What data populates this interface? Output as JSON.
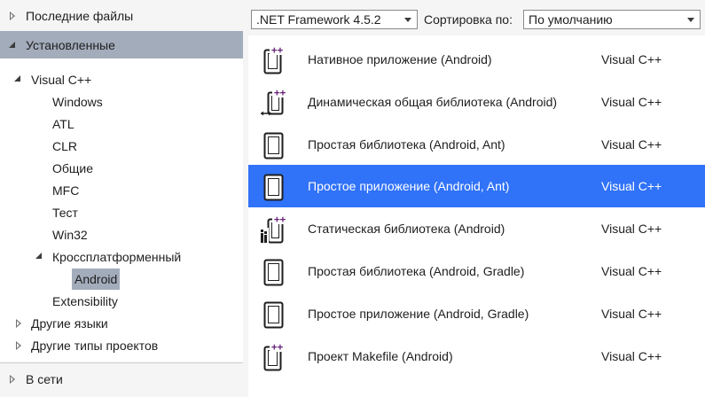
{
  "left": {
    "recent": "Последние файлы",
    "installed": "Установленные",
    "tree": {
      "visual_cpp": "Visual C++",
      "children": [
        "Windows",
        "ATL",
        "CLR",
        "Общие",
        "MFC",
        "Тест",
        "Win32"
      ],
      "cross_platform": "Кроссплатформенный",
      "android": "Android",
      "extensibility": "Extensibility",
      "other_languages": "Другие языки",
      "other_project_types": "Другие типы проектов"
    },
    "online": "В сети"
  },
  "toolbar": {
    "framework": ".NET Framework 4.5.2",
    "sort_label": "Сортировка по:",
    "sort_value": "По умолчанию"
  },
  "templates": [
    {
      "name": "Нативное приложение (Android)",
      "lang": "Visual C++",
      "icon": "native-app-icon"
    },
    {
      "name": "Динамическая общая библиотека (Android)",
      "lang": "Visual C++",
      "icon": "dynamic-library-icon"
    },
    {
      "name": "Простая библиотека (Android, Ant)",
      "lang": "Visual C++",
      "icon": "phone-icon"
    },
    {
      "name": "Простое приложение (Android, Ant)",
      "lang": "Visual C++",
      "icon": "phone-icon",
      "selected": true
    },
    {
      "name": "Статическая библиотека (Android)",
      "lang": "Visual C++",
      "icon": "static-library-icon"
    },
    {
      "name": "Простая библиотека (Android, Gradle)",
      "lang": "Visual C++",
      "icon": "phone-icon"
    },
    {
      "name": "Простое приложение (Android, Gradle)",
      "lang": "Visual C++",
      "icon": "phone-icon"
    },
    {
      "name": "Проект Makefile (Android)",
      "lang": "Visual C++",
      "icon": "makefile-icon"
    }
  ],
  "colors": {
    "selection": "#3072f8",
    "section_selected": "#a3acbb",
    "cpp_purple": "#68217a"
  }
}
